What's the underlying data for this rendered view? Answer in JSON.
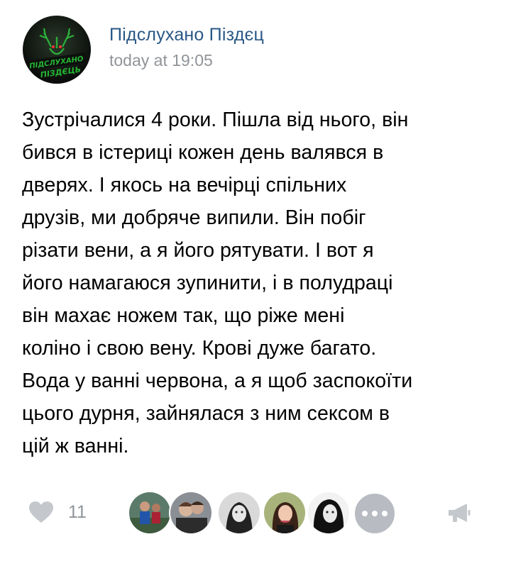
{
  "post": {
    "author": "Підслухано Піздєц",
    "time": "today at 19:05",
    "avatar_logo_text": "ПІДСЛУХАНО ПІЗДЄЦЬ",
    "text": "Зустрічалися 4 роки. Пішла від нього, він\nбився в істериці кожен день валявся в\nдверях. І якось на вечірці спільних\nдрузів, ми добряче випили. Він побіг\nрізати вени, а я його рятувати. І вот я\nйого намагаюся зупинити, і в полудраці\nвін махає ножем так, що ріже мені\nколіно і свою вену. Крові дуже багато.\nВода у ванні червона, а я щоб заспокоїти\nцього дурня, зайнялася з ним сексом в\nцій ж ванні."
  },
  "footer": {
    "like_icon": "heart-icon",
    "like_count": "11",
    "likers": [
      {
        "name": "liker-avatar-1"
      },
      {
        "name": "liker-avatar-2"
      },
      {
        "name": "liker-avatar-3"
      },
      {
        "name": "liker-avatar-4"
      },
      {
        "name": "liker-avatar-5"
      }
    ],
    "more_icon": "more-dots-icon",
    "share_icon": "megaphone-icon"
  },
  "colors": {
    "author_link": "#2a5885",
    "meta_gray": "#909499",
    "icon_gray": "#c4c8cc",
    "avatar_green": "#1f9a2e"
  }
}
